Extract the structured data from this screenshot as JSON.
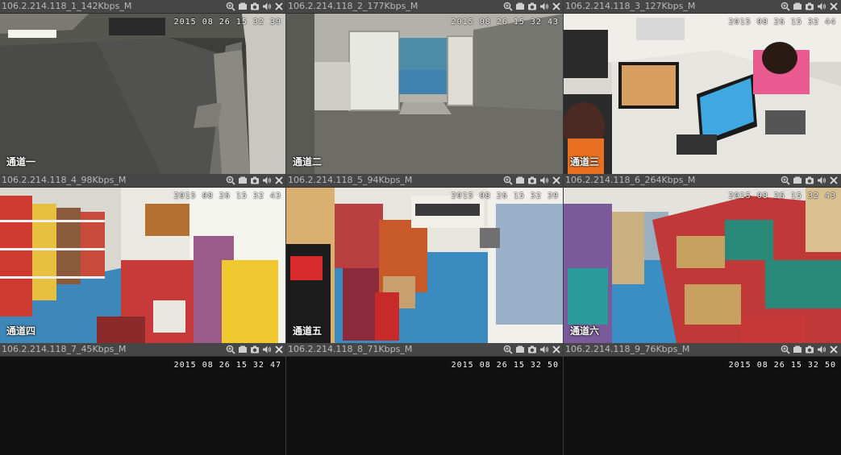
{
  "colors": {
    "background": "#111111",
    "header": "#464646",
    "title_text": "#b9b9b9",
    "selected_border": "#33c233"
  },
  "cells": [
    {
      "title": "106.2.214.118_1_142Kbps_M",
      "timestamp": "2015 08 26 15 32 39",
      "channel": "通道一",
      "scene": "parking",
      "selected": true
    },
    {
      "title": "106.2.214.118_2_177Kbps_M",
      "timestamp": "2015 08 26 15 32 43",
      "channel": "通道二",
      "scene": "doors",
      "selected": false
    },
    {
      "title": "106.2.214.118_3_127Kbps_M",
      "timestamp": "2015 08 26 15 32 44",
      "channel": "通道三",
      "scene": "office",
      "selected": false
    },
    {
      "title": "106.2.214.118_4_98Kbps_M",
      "timestamp": "2015 08 26 15 32 43",
      "channel": "通道四",
      "scene": "store_left",
      "selected": false
    },
    {
      "title": "106.2.214.118_5_94Kbps_M",
      "timestamp": "2015 08 26 15 32 39",
      "channel": "通道五",
      "scene": "store_mid",
      "selected": false
    },
    {
      "title": "106.2.214.118_6_264Kbps_M",
      "timestamp": "2015 08 26 15 32 43",
      "channel": "通道六",
      "scene": "warehouse",
      "selected": false
    },
    {
      "title": "106.2.214.118_7_45Kbps_M",
      "timestamp": "2015 08 26 15 32 47",
      "channel": "",
      "scene": "black",
      "selected": false
    },
    {
      "title": "106.2.214.118_8_71Kbps_M",
      "timestamp": "2015 08 26 15 32 50",
      "channel": "",
      "scene": "black",
      "selected": false
    },
    {
      "title": "106.2.214.118_9_76Kbps_M",
      "timestamp": "2015 08 26 15 32 50",
      "channel": "",
      "scene": "black",
      "selected": false
    }
  ],
  "toolbar_icons": [
    "zoom-icon",
    "record-icon",
    "snapshot-icon",
    "audio-icon",
    "close-icon"
  ]
}
